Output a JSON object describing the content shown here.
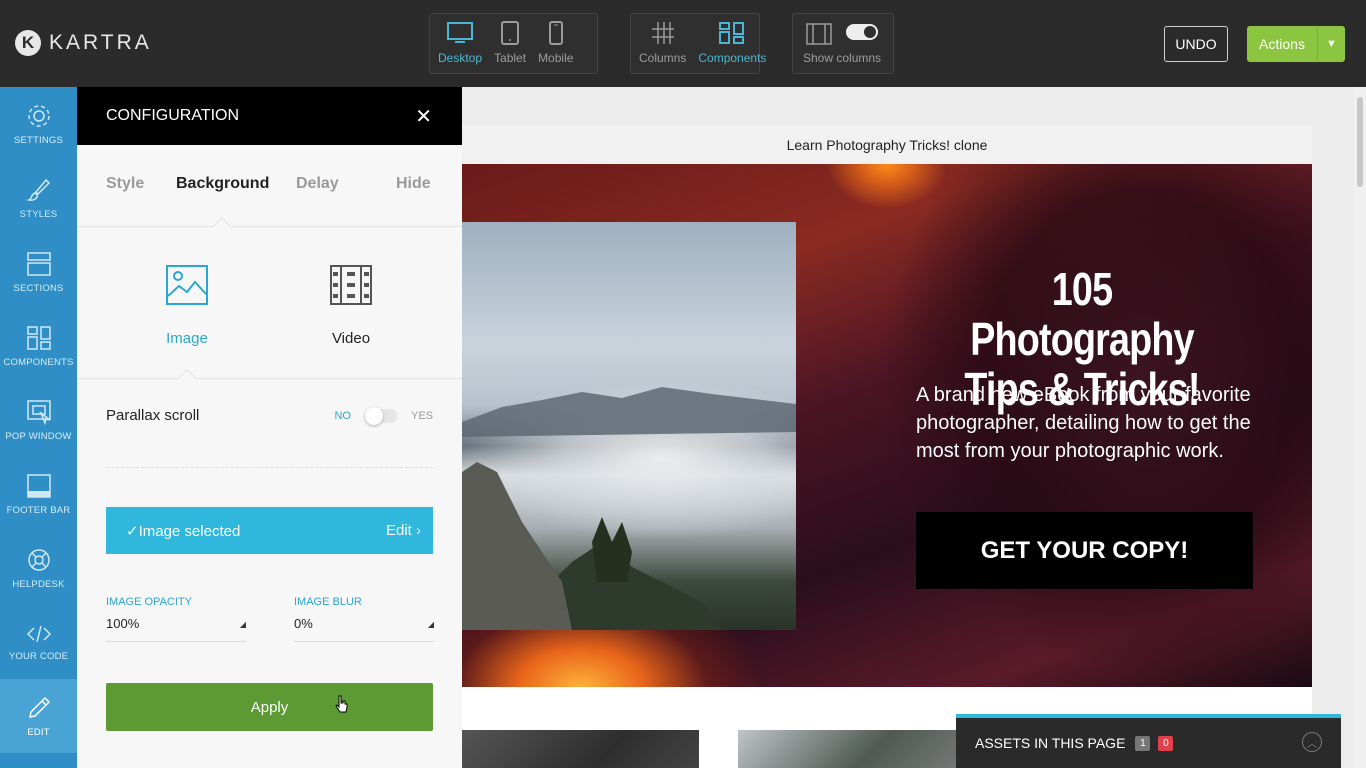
{
  "brand": {
    "logo_letter": "K",
    "name": "KARTRA"
  },
  "toolbar": {
    "view_buttons": [
      "Desktop",
      "Tablet",
      "Mobile"
    ],
    "layout_buttons": [
      "Columns",
      "Components"
    ],
    "show_columns_label": "Show columns",
    "undo_label": "UNDO",
    "actions_label": "Actions"
  },
  "sidebar": {
    "items": [
      "SETTINGS",
      "STYLES",
      "SECTIONS",
      "COMPONENTS",
      "POP WINDOW",
      "FOOTER BAR",
      "HELPDESK",
      "YOUR CODE",
      "EDIT"
    ]
  },
  "config": {
    "title": "CONFIGURATION",
    "close": "✕",
    "tabs": [
      "Style",
      "Background",
      "Delay",
      "Hide"
    ],
    "media": [
      "Image",
      "Video"
    ],
    "parallax_label": "Parallax scroll",
    "parallax_no": "NO",
    "parallax_yes": "YES",
    "image_selected": "✓Image selected",
    "edit_label": "Edit ›",
    "opacity_label": "IMAGE OPACITY",
    "opacity_value": "100%",
    "blur_label": "IMAGE BLUR",
    "blur_value": "0%",
    "apply_label": "Apply"
  },
  "canvas": {
    "page_title": "Learn Photography Tricks! clone",
    "hero_heading_line1": "105 Photography",
    "hero_heading_line2": "Tips & Tricks!",
    "hero_sub": "A brand new eBook from your favorite photographer, detailing how to get the most from your photographic work.",
    "cta": "GET YOUR COPY!"
  },
  "assets": {
    "label": "ASSETS IN THIS PAGE",
    "count_grey": "1",
    "count_red": "0"
  },
  "colors": {
    "accent": "#2fb7dd",
    "sidebar": "#2e8ec5",
    "apply": "#5d9a33",
    "actions": "#8cc641"
  }
}
